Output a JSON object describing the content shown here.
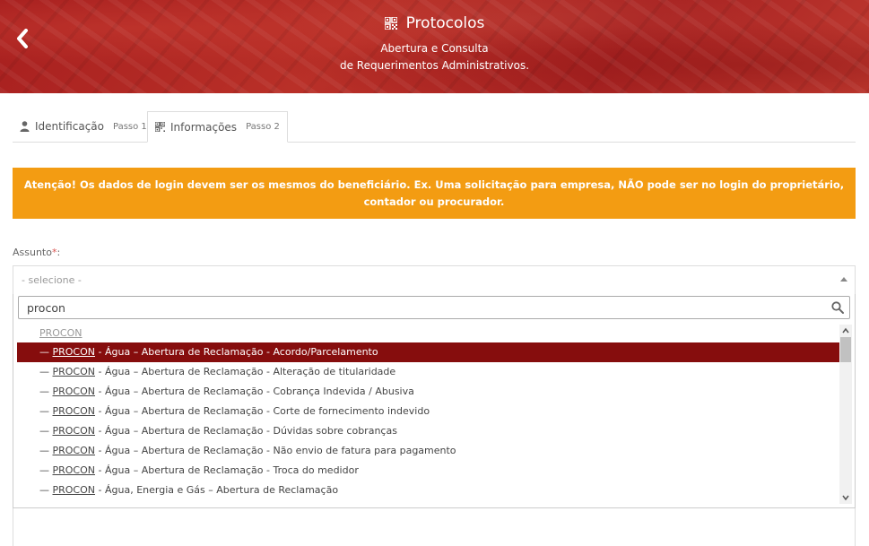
{
  "header": {
    "title": "Protocolos",
    "subtitle_line1": "Abertura e Consulta",
    "subtitle_line2": "de Requerimentos Administrativos.",
    "title_icon": "qrcode-icon",
    "back_icon": "chevron-left-icon"
  },
  "tabs": [
    {
      "label": "Identificação",
      "step": "Passo 1",
      "icon": "user-icon"
    },
    {
      "label": "Informações",
      "step": "Passo 2",
      "icon": "qrcode-icon"
    }
  ],
  "alert": {
    "text": "Atenção! Os dados de login devem ser os mesmos do beneficiário. Ex. Uma solicitação para empresa, NÃO pode ser no login do proprietário, contador ou procurador.",
    "color": "#f39c12"
  },
  "form": {
    "subject_label": "Assunto",
    "required_mark": "*",
    "required_suffix": ":",
    "select_placeholder": "- selecione -",
    "search_value": "procon"
  },
  "results": {
    "group": "PROCON",
    "prefix": "—",
    "keyword": "PROCON",
    "options": [
      " - Água – Abertura de Reclamação - Acordo/Parcelamento",
      " - Água – Abertura de Reclamação - Alteração de titularidade",
      " - Água – Abertura de Reclamação - Cobrança Indevida / Abusiva",
      " - Água – Abertura de Reclamação - Corte de fornecimento indevido",
      " - Água – Abertura de Reclamação - Dúvidas sobre cobranças",
      " - Água – Abertura de Reclamação - Não envio de fatura para pagamento",
      " - Água – Abertura de Reclamação - Troca do medidor",
      " - Água, Energia e Gás – Abertura de Reclamação"
    ],
    "highlight_color": "#860d0d"
  }
}
